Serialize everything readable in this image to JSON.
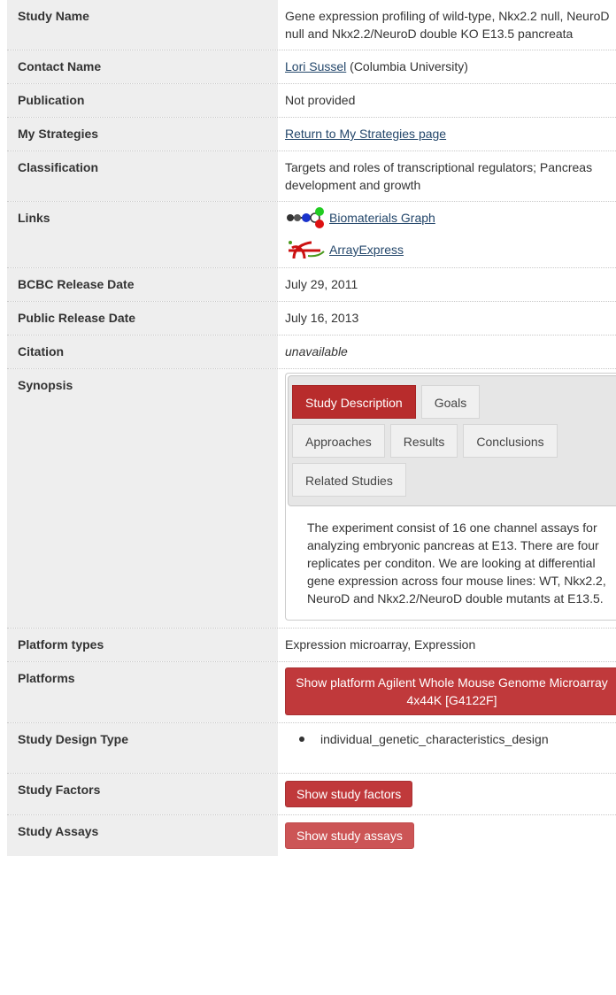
{
  "rows": {
    "study_name": {
      "label": "Study Name",
      "value": "Gene expression profiling of wild-type, Nkx2.2 null, NeuroD null and Nkx2.2/NeuroD double KO E13.5 pancreata"
    },
    "contact": {
      "label": "Contact Name",
      "link": "Lori Sussel",
      "value": "(Columbia University)"
    },
    "publication": {
      "label": "Publication",
      "value": "Not provided"
    },
    "strategies": {
      "label": "My Strategies",
      "link": "Return to My Strategies page"
    },
    "classification": {
      "label": "Classification",
      "value": "Targets and roles of transcriptional regulators; Pancreas development and growth"
    },
    "links": {
      "label": "Links",
      "items": [
        {
          "text": "Biomaterials Graph",
          "icon": "biomaterials-graph-icon"
        },
        {
          "text": "ArrayExpress",
          "icon": "arrayexpress-logo-icon"
        }
      ]
    },
    "bcbc_release": {
      "label": "BCBC Release Date",
      "value": "July 29, 2011"
    },
    "public_release": {
      "label": "Public Release Date",
      "value": "July 16, 2013"
    },
    "citation": {
      "label": "Citation",
      "value": "unavailable"
    },
    "synopsis": {
      "label": "Synopsis",
      "tabs": [
        "Study Description",
        "Goals",
        "Approaches",
        "Results",
        "Conclusions",
        "Related Studies"
      ],
      "active_tab": "Study Description",
      "description": "The experiment consist of 16 one channel assays for analyzing embryonic pancreas at E13. There are four replicates per conditon. We are looking at differential gene expression across four mouse lines: WT, Nkx2.2, NeuroD and Nkx2.2/NeuroD double mutants at E13.5."
    },
    "platform_types": {
      "label": "Platform types",
      "value": "Expression microarray, Expression"
    },
    "platforms": {
      "label": "Platforms",
      "button": "Show platform Agilent Whole Mouse Genome Microarray 4x44K [G4122F]"
    },
    "design_type": {
      "label": "Study Design Type",
      "items": [
        "individual_genetic_characteristics_design"
      ]
    },
    "factors": {
      "label": "Study Factors",
      "button": "Show study factors"
    },
    "assays": {
      "label": "Study Assays",
      "button": "Show study assays"
    }
  },
  "colors": {
    "accent_red": "#c0393b",
    "active_tab": "#b82c2c",
    "link": "#24476b",
    "label_bg": "#eeeeee"
  }
}
